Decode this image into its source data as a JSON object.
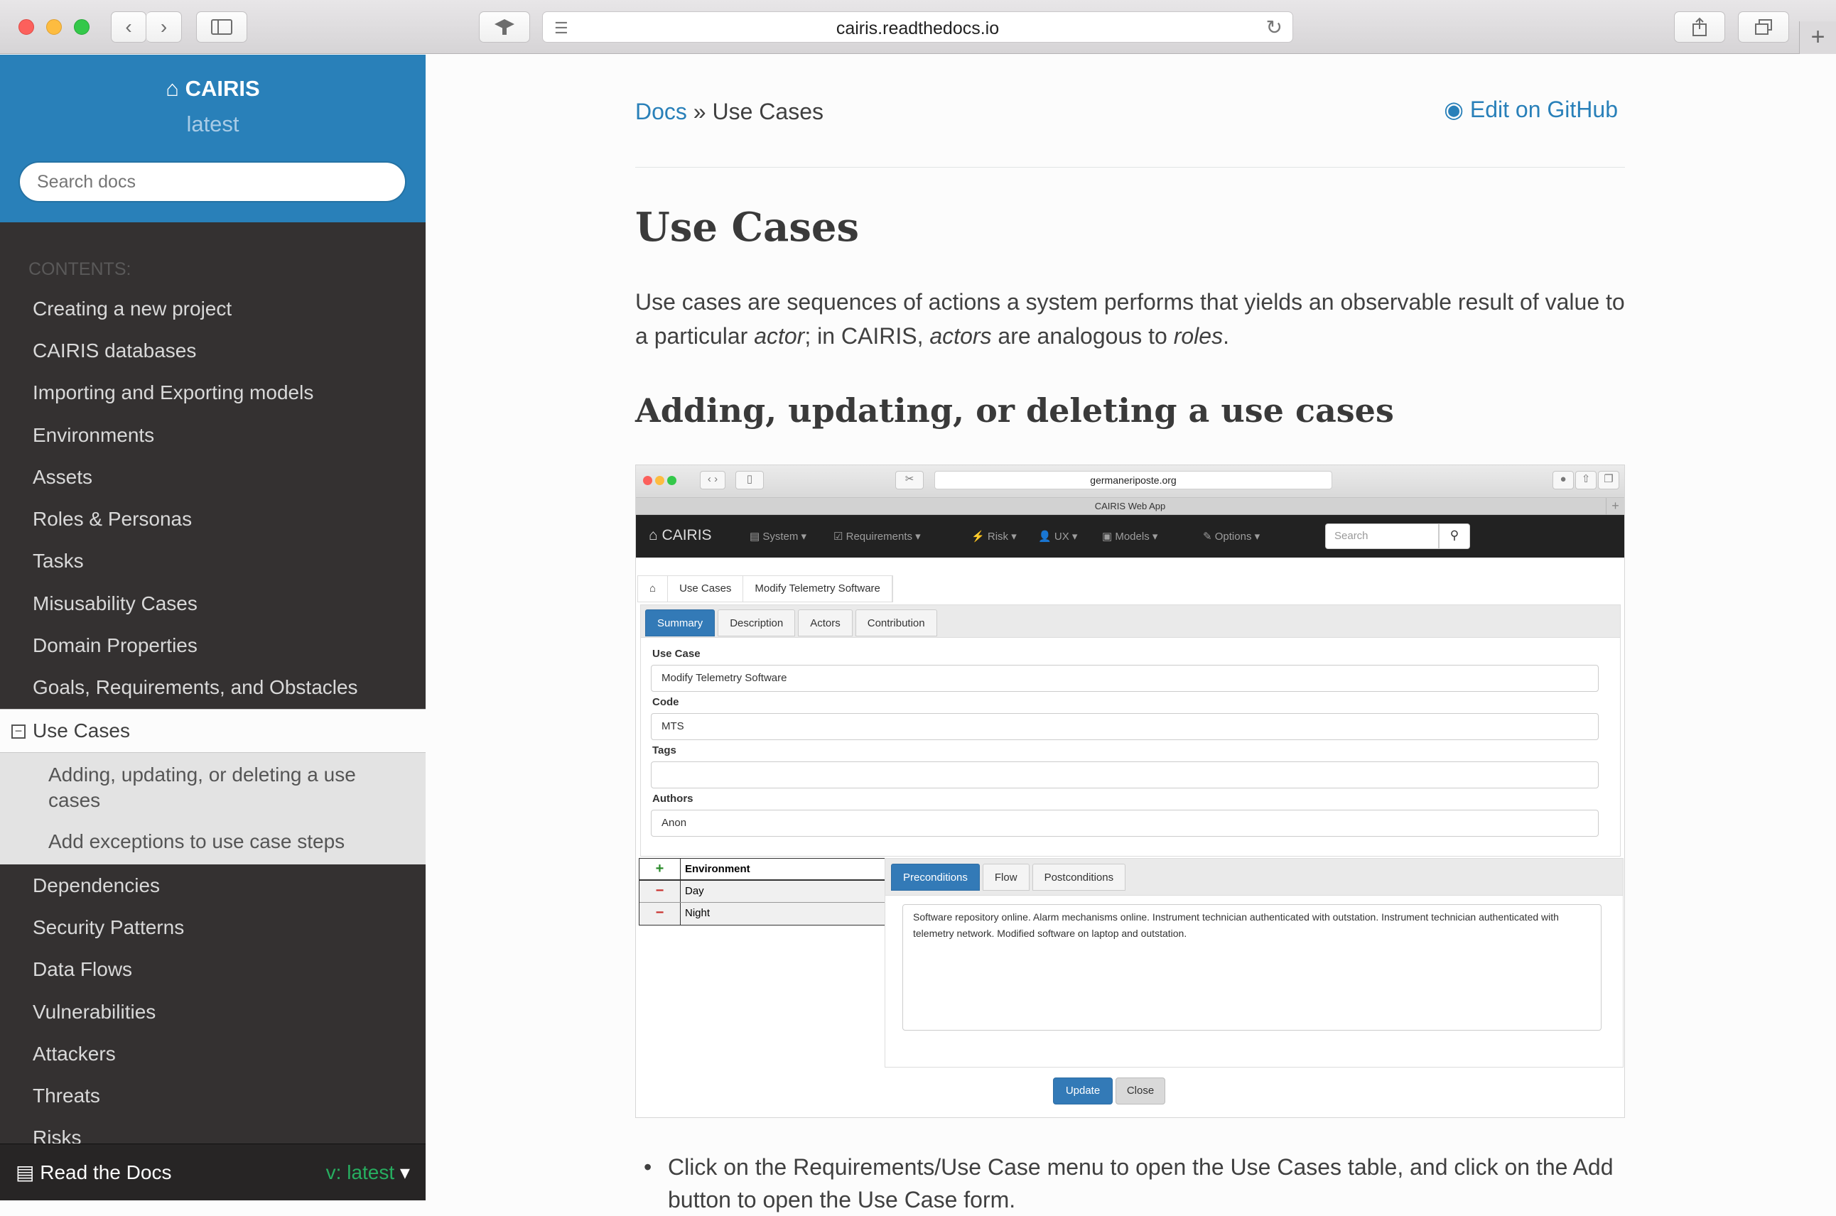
{
  "browser": {
    "url": "cairis.readthedocs.io",
    "back_icon": "chevron-left",
    "forward_icon": "chevron-right",
    "sidebar_icon": "sidebar",
    "reader_icon": "reader-lines",
    "reload_icon": "reload",
    "share_icon": "share",
    "tabs_icon": "tabs",
    "new_tab": "+"
  },
  "sidebar": {
    "brand": "CAIRIS",
    "version": "latest",
    "search_placeholder": "Search docs",
    "caption": "CONTENTS:",
    "items_before": [
      "Creating a new project",
      "CAIRIS databases",
      "Importing and Exporting models",
      "Environments",
      "Assets",
      "Roles & Personas",
      "Tasks",
      "Misusability Cases",
      "Domain Properties",
      "Goals, Requirements, and Obstacles"
    ],
    "current": "Use Cases",
    "current_toggle": "⊟",
    "subitems": [
      "Adding, updating, or deleting a use cases",
      "Add exceptions to use case steps"
    ],
    "items_after": [
      "Dependencies",
      "Security Patterns",
      "Data Flows",
      "Vulnerabilities",
      "Attackers",
      "Threats",
      "Risks"
    ],
    "footer_label": "Read the Docs",
    "footer_version": "v: latest"
  },
  "content": {
    "breadcrumb_home": "Docs",
    "breadcrumb_sep": "»",
    "breadcrumb_current": "Use Cases",
    "edit_link": "Edit on GitHub",
    "title": "Use Cases",
    "lead_1": "Use cases are sequences of actions a system performs that yields an observable result of value to a particular ",
    "lead_actor": "actor",
    "lead_2": "; in CAIRIS, ",
    "lead_actors": "actors",
    "lead_3": " are analogous to ",
    "lead_roles": "roles",
    "lead_4": ".",
    "section_title": "Adding, updating, or deleting a use cases",
    "bullet": "Click on the Requirements/Use Case menu to open the Use Cases table, and click on the Add button to open the Use Case form."
  },
  "screenshot": {
    "url": "germaneriposte.org",
    "window_title": "CAIRIS Web App",
    "brand": "CAIRIS",
    "menus": [
      "System",
      "Requirements",
      "Risk",
      "UX",
      "Models",
      "Options"
    ],
    "search_placeholder": "Search",
    "breadcrumb": [
      "Use Cases",
      "Modify Telemetry Software"
    ],
    "tabs": [
      "Summary",
      "Description",
      "Actors",
      "Contribution"
    ],
    "use_case_label": "Use Case",
    "use_case_value": "Modify Telemetry Software",
    "code_label": "Code",
    "code_value": "MTS",
    "tags_label": "Tags",
    "tags_value": "",
    "authors_label": "Authors",
    "authors_value": "Anon",
    "env_header": "Environment",
    "environments": [
      "Day",
      "Night"
    ],
    "cond_tabs": [
      "Preconditions",
      "Flow",
      "Postconditions"
    ],
    "preconditions": "Software repository online.  Alarm mechanisms online.  Instrument technician authenticated with outstation.  Instrument technician authenticated with telemetry network.  Modified software on laptop and outstation.",
    "update_label": "Update",
    "close_label": "Close"
  }
}
